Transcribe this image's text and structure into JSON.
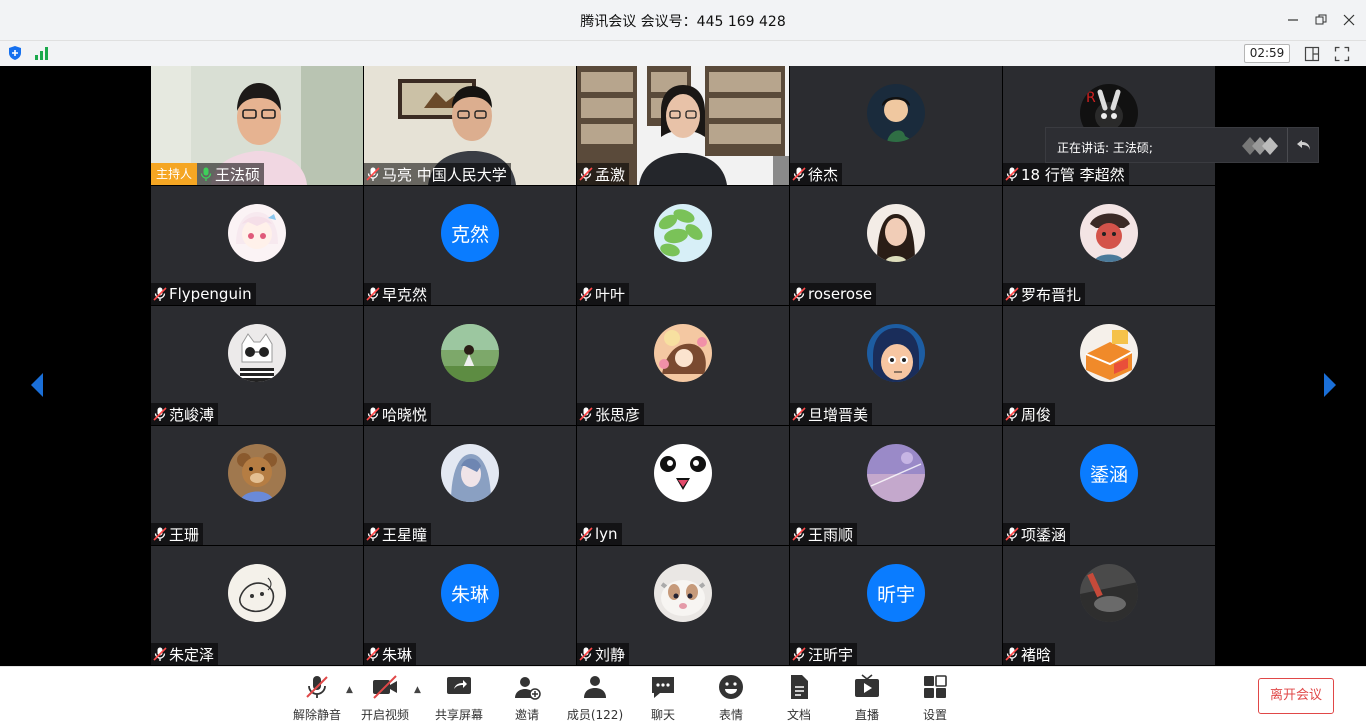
{
  "window": {
    "title": "腾讯会议  会议号：445 169 428"
  },
  "status": {
    "timer": "02:59"
  },
  "speaking": {
    "label": "正在讲话: 王法硕;"
  },
  "host_badge": "主持人",
  "participants": [
    {
      "name": "王法硕",
      "host": true,
      "video": "v1"
    },
    {
      "name": "马亮 中国人民大学",
      "video": "v2"
    },
    {
      "name": "孟激",
      "video": "v3"
    },
    {
      "name": "徐杰",
      "avatar": "a1"
    },
    {
      "name": "18 行管 李超然",
      "avatar": "a2"
    },
    {
      "name": "Flypenguin",
      "avatar": "a3"
    },
    {
      "name": "早克然",
      "avatar_text": "克然"
    },
    {
      "name": "叶叶",
      "avatar": "a4"
    },
    {
      "name": "roserose",
      "avatar": "a5"
    },
    {
      "name": "罗布晋扎",
      "avatar": "a6"
    },
    {
      "name": "范峻溥",
      "avatar": "a7"
    },
    {
      "name": "哈晓悦",
      "avatar": "a8"
    },
    {
      "name": "张思彦",
      "avatar": "a9"
    },
    {
      "name": "旦增晋美",
      "avatar": "a10"
    },
    {
      "name": "周俊",
      "avatar": "a11"
    },
    {
      "name": "王珊",
      "avatar": "a12"
    },
    {
      "name": "王星瞳",
      "avatar": "a13"
    },
    {
      "name": "lyn",
      "avatar": "a14"
    },
    {
      "name": "王雨顺",
      "avatar": "a15"
    },
    {
      "name": "项鋈涵",
      "avatar_text": "鋈涵"
    },
    {
      "name": "朱定泽",
      "avatar": "a16"
    },
    {
      "name": "朱琳",
      "avatar_text": "朱琳"
    },
    {
      "name": "刘静",
      "avatar": "a17"
    },
    {
      "name": "汪昕宇",
      "avatar_text": "昕宇"
    },
    {
      "name": "褚晗",
      "avatar": "a18"
    }
  ],
  "toolbar": {
    "mute": "解除静音",
    "video": "开启视频",
    "share": "共享屏幕",
    "invite": "邀请",
    "members": "成员(122)",
    "chat": "聊天",
    "emoji": "表情",
    "docs": "文档",
    "live": "直播",
    "settings": "设置",
    "leave": "离开会议"
  },
  "colors": {
    "accent": "#0a7cff",
    "leave": "#e04848",
    "host": "#f5a623",
    "tile": "#2b2c30"
  }
}
